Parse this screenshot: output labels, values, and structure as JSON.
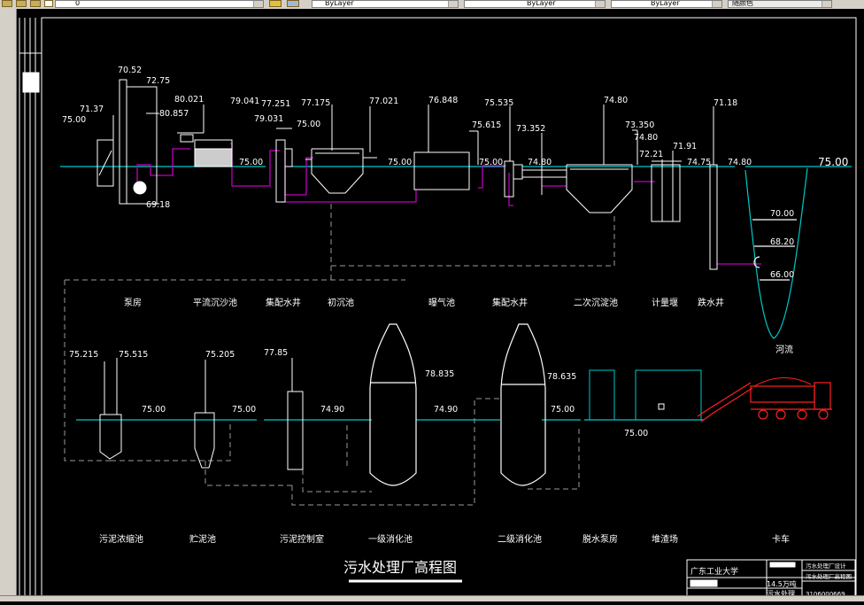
{
  "toolbar": {
    "layer_name": "0",
    "color_combo": "ByLayer",
    "linetype_combo": "ByLayer",
    "lineweight_combo": "ByLayer",
    "plotstyle_combo": "随颜色"
  },
  "colors": {
    "background": "#000000",
    "white_line": "#ffffff",
    "ground": "#00c8c8",
    "sludge_pipe": "#c000c0",
    "dashed": "#909090",
    "truck": "#ff2020"
  },
  "elevations": {
    "pump_room_left": "75.00",
    "pump_inlet": "71.37",
    "pump_top": "70.52",
    "pump_mid": "72.75",
    "pump_bottom": "69.18",
    "grit_top": "80.021",
    "grit_in": "80.857",
    "grit_ground": "75.00",
    "dist1_top": "79.041",
    "dist1_a": "77.251",
    "dist1_b": "79.031",
    "dist1_ground": "75.00",
    "primary_top": "77.175",
    "primary_right": "77.021",
    "primary_ground": "75.00",
    "aeration_top": "76.848",
    "aeration_right": "75.615",
    "aeration_ground": "75.00",
    "dist2_top": "75.535",
    "dist2_b": "73.352",
    "dist2_ground": "74.80",
    "secondary_top": "74.80",
    "secondary_b": "73.350",
    "secondary_c": "74.80",
    "meter_a": "72.21",
    "meter_b": "71.91",
    "meter_ground": "74.75",
    "outfall_top": "71.18",
    "outfall_ground": "74.80",
    "river_top": "75.00",
    "river_1": "70.00",
    "river_2": "68.20",
    "river_3": "66.00",
    "thick_a": "75.215",
    "thick_b": "75.515",
    "thick_ground": "75.00",
    "store_top": "75.205",
    "store_ground": "75.00",
    "ctrl_top": "77.85",
    "ctrl_ground": "74.90",
    "dig1_level": "78.835",
    "dig1_ground": "74.90",
    "dig2_level": "78.635",
    "dig2_ground": "75.00",
    "dewater_ground": "75.00"
  },
  "labels": {
    "pump_room": "泵房",
    "grit_chamber": "平流沉沙池",
    "distribution_well_1": "集配水井",
    "primary_clarifier": "初沉池",
    "aeration_tank": "曝气池",
    "distribution_well_2": "集配水井",
    "secondary_clarifier": "二次沉淀池",
    "metering_weir": "计量堰",
    "outfall_well": "跌水井",
    "river": "河流",
    "sludge_thickener": "污泥浓缩池",
    "sludge_storage": "贮泥池",
    "sludge_control_room": "污泥控制室",
    "primary_digester": "一级消化池",
    "secondary_digester": "二级消化池",
    "dewatering_pump_room": "脱水泵房",
    "cake_yard": "堆渣场",
    "truck": "卡车"
  },
  "drawing_title": "污水处理厂高程图",
  "title_block": {
    "school": "广东工业大学",
    "design_title": "污水处理厂设计",
    "design_sub": "污水处理厂高程图",
    "capacity": "14.5万吨",
    "project": "污水处理",
    "drawing_no": "3106000669"
  }
}
